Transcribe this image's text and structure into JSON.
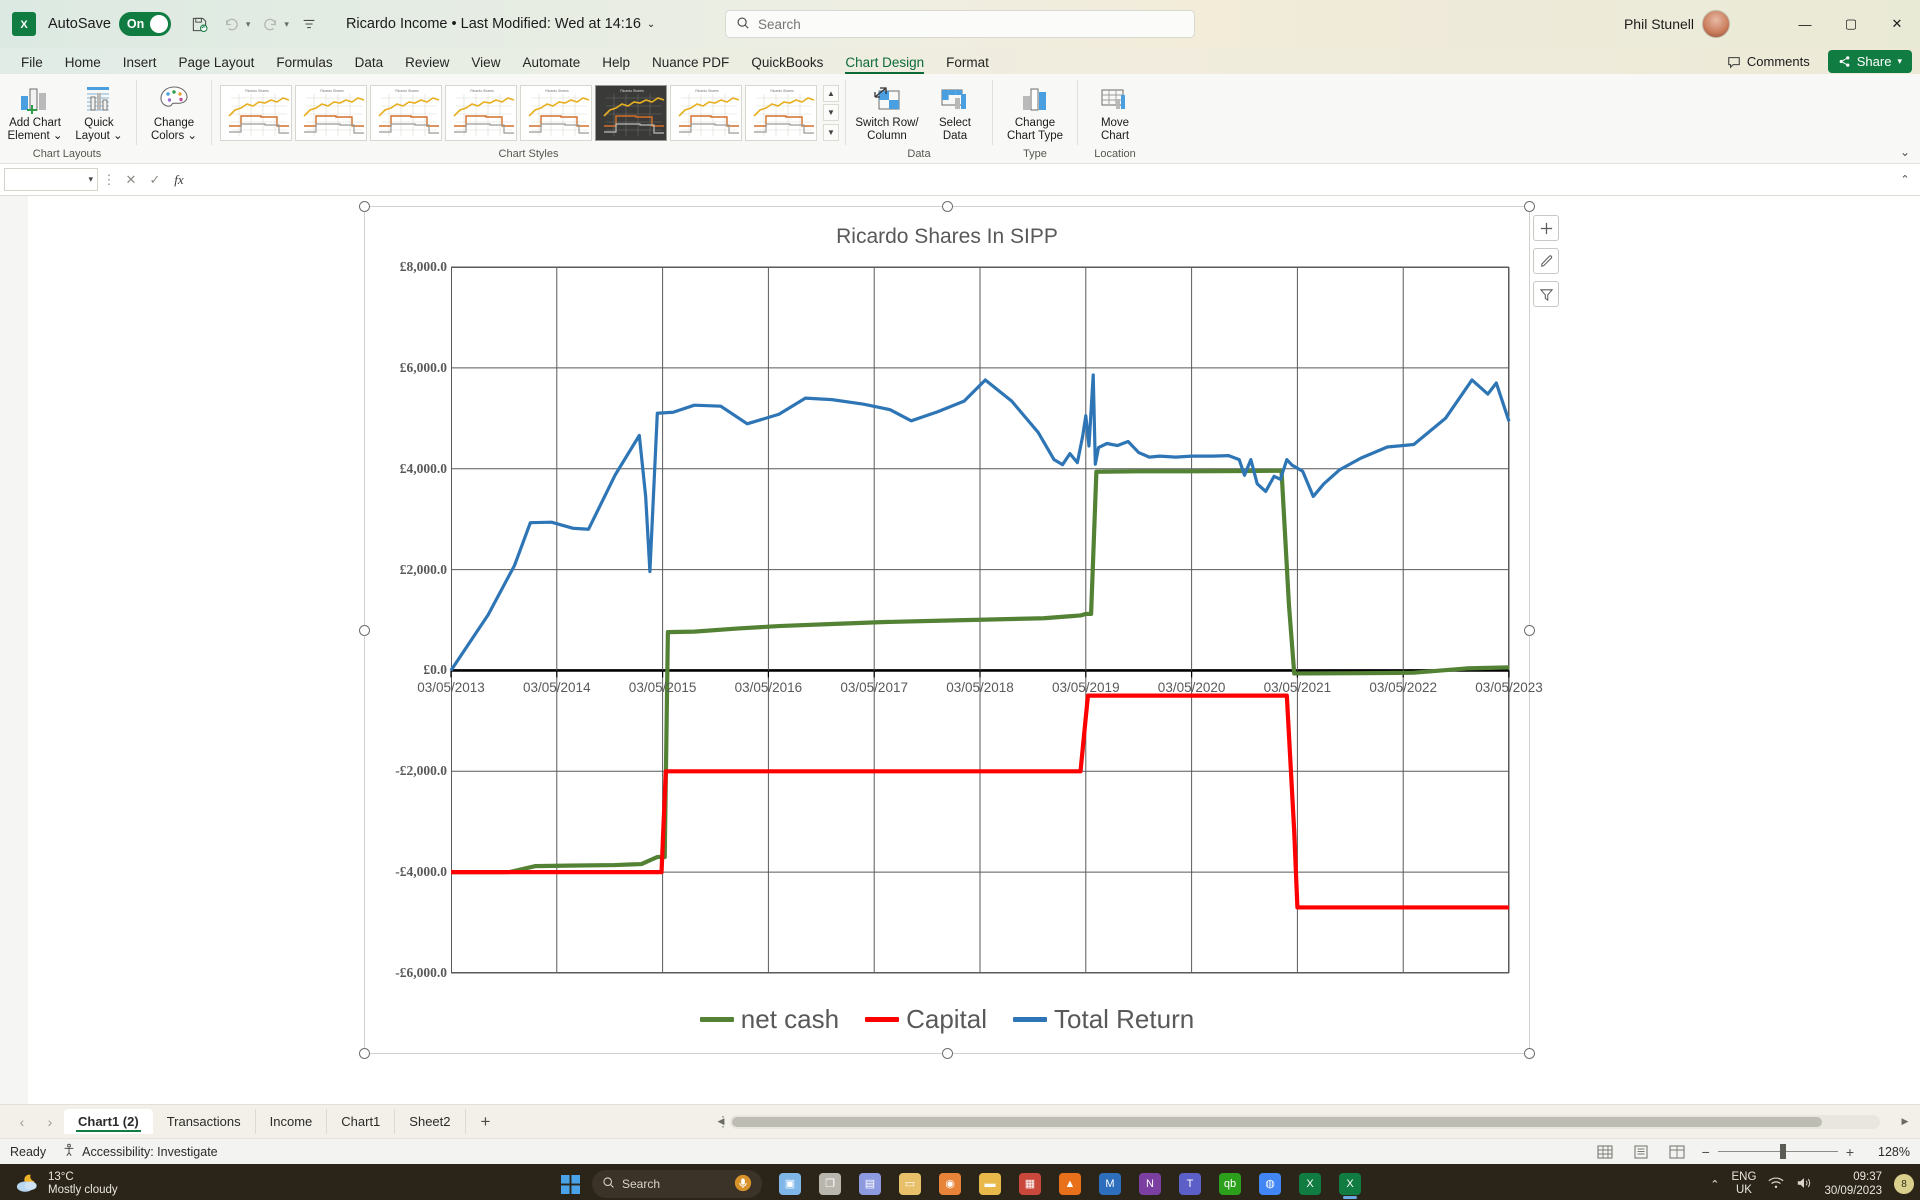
{
  "titlebar": {
    "app_icon": "excel-logo",
    "autosave_label": "AutoSave",
    "autosave_state": "On",
    "document_title": "Ricardo Income  •  Last Modified: Wed at 14:16",
    "save_icon": "save-icon",
    "undo_icon": "undo-icon",
    "redo_icon": "redo-icon",
    "customize_icon": "customize-qat-icon",
    "user_name": "Phil Stunell",
    "minimize": "—",
    "maximize": "▢",
    "close": "✕"
  },
  "search": {
    "placeholder": "Search",
    "icon": "search-icon"
  },
  "ribbon": {
    "tabs": [
      {
        "label": "File",
        "active": false
      },
      {
        "label": "Home",
        "active": false
      },
      {
        "label": "Insert",
        "active": false
      },
      {
        "label": "Page Layout",
        "active": false
      },
      {
        "label": "Formulas",
        "active": false
      },
      {
        "label": "Data",
        "active": false
      },
      {
        "label": "Review",
        "active": false
      },
      {
        "label": "View",
        "active": false
      },
      {
        "label": "Automate",
        "active": false
      },
      {
        "label": "Help",
        "active": false
      },
      {
        "label": "Nuance PDF",
        "active": false
      },
      {
        "label": "QuickBooks",
        "active": false
      },
      {
        "label": "Chart Design",
        "active": true
      },
      {
        "label": "Format",
        "active": false
      }
    ],
    "comments_label": "Comments",
    "share_label": "Share",
    "collapse_icon": "chevron-up-icon",
    "groups": [
      {
        "name": "Chart Layouts",
        "buttons": [
          {
            "label": "Add Chart\nElement",
            "icon": "add-chart-element-icon",
            "caret": true
          },
          {
            "label": "Quick\nLayout",
            "icon": "quick-layout-icon",
            "caret": true
          }
        ]
      },
      {
        "name": "",
        "buttons": [
          {
            "label": "Change\nColors",
            "icon": "change-colors-icon",
            "caret": true
          }
        ]
      },
      {
        "name": "Chart Styles",
        "buttons": []
      },
      {
        "name": "Data",
        "buttons": [
          {
            "label": "Switch Row/\nColumn",
            "icon": "switch-row-column-icon",
            "caret": false
          },
          {
            "label": "Select\nData",
            "icon": "select-data-icon",
            "caret": false
          }
        ]
      },
      {
        "name": "Type",
        "buttons": [
          {
            "label": "Change\nChart Type",
            "icon": "change-chart-type-icon",
            "caret": false
          }
        ]
      },
      {
        "name": "Location",
        "buttons": [
          {
            "label": "Move\nChart",
            "icon": "move-chart-icon",
            "caret": false
          }
        ]
      }
    ],
    "style_gallery_selected_index": 5,
    "style_gallery_count": 8
  },
  "formula_bar": {
    "name_box_value": "",
    "cancel_icon": "cancel-icon",
    "confirm_icon": "confirm-icon",
    "fx_icon": "insert-function-icon",
    "input_value": "",
    "expand_icon": "expand-formula-bar-icon"
  },
  "chart_tools": [
    {
      "name": "chart-elements-button",
      "glyph": "+"
    },
    {
      "name": "chart-styles-button",
      "glyph": "✎"
    },
    {
      "name": "chart-filters-button",
      "glyph": "▽"
    }
  ],
  "chart_data": {
    "type": "line",
    "title": "Ricardo Shares In SIPP",
    "xlabel": "",
    "ylabel": "",
    "grid": true,
    "legend_position": "bottom",
    "ylim": [
      -6000,
      8000
    ],
    "yticks": [
      8000,
      6000,
      4000,
      2000,
      0,
      -2000,
      -4000,
      -6000
    ],
    "ytick_labels": [
      "£8,000.0",
      "£6,000.0",
      "£4,000.0",
      "£2,000.0",
      "£0.0",
      "-£2,000.0",
      "-£4,000.0",
      "-£6,000.0"
    ],
    "xtick_labels": [
      "03/05/2013",
      "03/05/2014",
      "03/05/2015",
      "03/05/2016",
      "03/05/2017",
      "03/05/2018",
      "03/05/2019",
      "03/05/2020",
      "03/05/2021",
      "03/05/2022",
      "03/05/2023"
    ],
    "colors": {
      "net cash": "#548235",
      "Capital": "#FF0000",
      "Total Return": "#2E75B6"
    },
    "series": [
      {
        "name": "net cash",
        "color": "#548235",
        "points": [
          {
            "x": 0.0,
            "y": -4000
          },
          {
            "x": 0.55,
            "y": -4000
          },
          {
            "x": 0.8,
            "y": -3880
          },
          {
            "x": 1.1,
            "y": -3870
          },
          {
            "x": 1.55,
            "y": -3860
          },
          {
            "x": 1.8,
            "y": -3840
          },
          {
            "x": 1.95,
            "y": -3700
          },
          {
            "x": 2.02,
            "y": -3700
          },
          {
            "x": 2.05,
            "y": 760
          },
          {
            "x": 2.3,
            "y": 770
          },
          {
            "x": 2.7,
            "y": 830
          },
          {
            "x": 3.1,
            "y": 880
          },
          {
            "x": 3.6,
            "y": 920
          },
          {
            "x": 4.1,
            "y": 960
          },
          {
            "x": 4.6,
            "y": 985
          },
          {
            "x": 5.1,
            "y": 1010
          },
          {
            "x": 5.6,
            "y": 1035
          },
          {
            "x": 5.85,
            "y": 1075
          },
          {
            "x": 5.95,
            "y": 1090
          },
          {
            "x": 6.0,
            "y": 1120
          },
          {
            "x": 6.05,
            "y": 1120
          },
          {
            "x": 6.1,
            "y": 3940
          },
          {
            "x": 6.5,
            "y": 3950
          },
          {
            "x": 7.0,
            "y": 3950
          },
          {
            "x": 7.5,
            "y": 3955
          },
          {
            "x": 7.85,
            "y": 3960
          },
          {
            "x": 7.92,
            "y": 1300
          },
          {
            "x": 7.97,
            "y": -60
          },
          {
            "x": 8.1,
            "y": -60
          },
          {
            "x": 8.6,
            "y": -55
          },
          {
            "x": 9.1,
            "y": -45
          },
          {
            "x": 9.6,
            "y": 40
          },
          {
            "x": 10.0,
            "y": 60
          }
        ]
      },
      {
        "name": "Capital",
        "color": "#FF0000",
        "points": [
          {
            "x": 0.0,
            "y": -4000
          },
          {
            "x": 1.0,
            "y": -4000
          },
          {
            "x": 1.9,
            "y": -4000
          },
          {
            "x": 1.99,
            "y": -4000
          },
          {
            "x": 2.03,
            "y": -2000
          },
          {
            "x": 3.0,
            "y": -2000
          },
          {
            "x": 4.0,
            "y": -2000
          },
          {
            "x": 5.0,
            "y": -2000
          },
          {
            "x": 5.95,
            "y": -2000
          },
          {
            "x": 6.02,
            "y": -500
          },
          {
            "x": 6.5,
            "y": -500
          },
          {
            "x": 7.0,
            "y": -500
          },
          {
            "x": 7.5,
            "y": -500
          },
          {
            "x": 7.9,
            "y": -500
          },
          {
            "x": 7.97,
            "y": -3200
          },
          {
            "x": 8.0,
            "y": -4700
          },
          {
            "x": 8.5,
            "y": -4700
          },
          {
            "x": 9.0,
            "y": -4700
          },
          {
            "x": 9.5,
            "y": -4700
          },
          {
            "x": 10.0,
            "y": -4700
          }
        ]
      },
      {
        "name": "Total Return",
        "color": "#2E75B6",
        "points": [
          {
            "x": 0.0,
            "y": 0
          },
          {
            "x": 0.35,
            "y": 1100
          },
          {
            "x": 0.6,
            "y": 2080
          },
          {
            "x": 0.75,
            "y": 2930
          },
          {
            "x": 0.95,
            "y": 2940
          },
          {
            "x": 1.15,
            "y": 2820
          },
          {
            "x": 1.3,
            "y": 2800
          },
          {
            "x": 1.55,
            "y": 3870
          },
          {
            "x": 1.78,
            "y": 4660
          },
          {
            "x": 1.84,
            "y": 3450
          },
          {
            "x": 1.88,
            "y": 1960
          },
          {
            "x": 1.95,
            "y": 5100
          },
          {
            "x": 2.1,
            "y": 5120
          },
          {
            "x": 2.3,
            "y": 5260
          },
          {
            "x": 2.55,
            "y": 5240
          },
          {
            "x": 2.8,
            "y": 4890
          },
          {
            "x": 3.1,
            "y": 5080
          },
          {
            "x": 3.35,
            "y": 5400
          },
          {
            "x": 3.6,
            "y": 5370
          },
          {
            "x": 3.9,
            "y": 5280
          },
          {
            "x": 4.15,
            "y": 5170
          },
          {
            "x": 4.35,
            "y": 4950
          },
          {
            "x": 4.6,
            "y": 5130
          },
          {
            "x": 4.85,
            "y": 5340
          },
          {
            "x": 5.05,
            "y": 5760
          },
          {
            "x": 5.3,
            "y": 5340
          },
          {
            "x": 5.55,
            "y": 4720
          },
          {
            "x": 5.7,
            "y": 4180
          },
          {
            "x": 5.78,
            "y": 4080
          },
          {
            "x": 5.85,
            "y": 4300
          },
          {
            "x": 5.92,
            "y": 4120
          },
          {
            "x": 5.97,
            "y": 4640
          },
          {
            "x": 6.0,
            "y": 5050
          },
          {
            "x": 6.03,
            "y": 4450
          },
          {
            "x": 6.07,
            "y": 5860
          },
          {
            "x": 6.09,
            "y": 4090
          },
          {
            "x": 6.12,
            "y": 4420
          },
          {
            "x": 6.2,
            "y": 4500
          },
          {
            "x": 6.3,
            "y": 4460
          },
          {
            "x": 6.4,
            "y": 4540
          },
          {
            "x": 6.5,
            "y": 4320
          },
          {
            "x": 6.6,
            "y": 4230
          },
          {
            "x": 6.7,
            "y": 4250
          },
          {
            "x": 6.85,
            "y": 4230
          },
          {
            "x": 7.0,
            "y": 4250
          },
          {
            "x": 7.2,
            "y": 4250
          },
          {
            "x": 7.35,
            "y": 4260
          },
          {
            "x": 7.45,
            "y": 4180
          },
          {
            "x": 7.5,
            "y": 3870
          },
          {
            "x": 7.56,
            "y": 4180
          },
          {
            "x": 7.62,
            "y": 3700
          },
          {
            "x": 7.7,
            "y": 3550
          },
          {
            "x": 7.78,
            "y": 3850
          },
          {
            "x": 7.84,
            "y": 3790
          },
          {
            "x": 7.9,
            "y": 4180
          },
          {
            "x": 7.95,
            "y": 4070
          },
          {
            "x": 8.05,
            "y": 3950
          },
          {
            "x": 8.15,
            "y": 3450
          },
          {
            "x": 8.25,
            "y": 3700
          },
          {
            "x": 8.4,
            "y": 3980
          },
          {
            "x": 8.6,
            "y": 4210
          },
          {
            "x": 8.85,
            "y": 4430
          },
          {
            "x": 9.1,
            "y": 4480
          },
          {
            "x": 9.4,
            "y": 5000
          },
          {
            "x": 9.65,
            "y": 5760
          },
          {
            "x": 9.8,
            "y": 5480
          },
          {
            "x": 9.88,
            "y": 5700
          },
          {
            "x": 10.0,
            "y": 4940
          }
        ]
      }
    ]
  },
  "sheet_tabs": {
    "prev_icon": "chevron-left-icon",
    "next_icon": "chevron-right-icon",
    "items": [
      {
        "label": "Chart1 (2)",
        "active": true
      },
      {
        "label": "Transactions",
        "active": false
      },
      {
        "label": "Income",
        "active": false
      },
      {
        "label": "Chart1",
        "active": false
      },
      {
        "label": "Sheet2",
        "active": false
      }
    ],
    "add_label": "+",
    "overflow_icon": "more-options-icon"
  },
  "statusbar": {
    "status": "Ready",
    "accessibility": "Accessibility: Investigate",
    "accessibility_icon": "accessibility-icon",
    "views": [
      {
        "name": "normal-view-button",
        "glyph": "▦"
      },
      {
        "name": "page-layout-view-button",
        "glyph": "▤"
      },
      {
        "name": "page-break-view-button",
        "glyph": "◫"
      }
    ],
    "zoom_out": "−",
    "zoom_in": "+",
    "zoom_level": "128%"
  },
  "taskbar": {
    "weather_temp": "13°C",
    "weather_desc": "Mostly cloudy",
    "search_placeholder": "Search",
    "search_icon": "search-icon",
    "start_icon": "windows-start-icon",
    "apps": [
      {
        "name": "widgets-icon",
        "glyph": "▣",
        "color": "#7fb7e8"
      },
      {
        "name": "task-view-icon",
        "glyph": "❐",
        "color": "#b9b6ae"
      },
      {
        "name": "chat-icon",
        "glyph": "▤",
        "color": "#8d9adf"
      },
      {
        "name": "file-explorer-icon",
        "glyph": "▭",
        "color": "#e8c06a"
      },
      {
        "name": "firefox-icon",
        "glyph": "◉",
        "color": "#e8833a"
      },
      {
        "name": "folder-icon",
        "glyph": "▬",
        "color": "#e8b84b"
      },
      {
        "name": "adobe-reader-icon",
        "glyph": "▦",
        "color": "#c9483b"
      },
      {
        "name": "vlc-icon",
        "glyph": "▲",
        "color": "#e8701a"
      },
      {
        "name": "outlook-icon",
        "glyph": "M",
        "color": "#2e6fbd"
      },
      {
        "name": "onenote-icon",
        "glyph": "N",
        "color": "#7a3fa0"
      },
      {
        "name": "teams-icon",
        "glyph": "T",
        "color": "#5b5fc7"
      },
      {
        "name": "quickbooks-icon",
        "glyph": "qb",
        "color": "#2ca01c"
      },
      {
        "name": "chrome-icon",
        "glyph": "◍",
        "color": "#4285f4"
      },
      {
        "name": "excel-app-icon",
        "glyph": "X",
        "color": "#107c41"
      },
      {
        "name": "excel-window-icon",
        "glyph": "X",
        "color": "#107c41"
      }
    ],
    "language": "ENG",
    "region": "UK",
    "network_icon": "wifi-icon",
    "volume_icon": "volume-icon",
    "time": "09:37",
    "date": "30/09/2023",
    "notification_count": "8",
    "chevron_icon": "chevron-up-icon"
  }
}
